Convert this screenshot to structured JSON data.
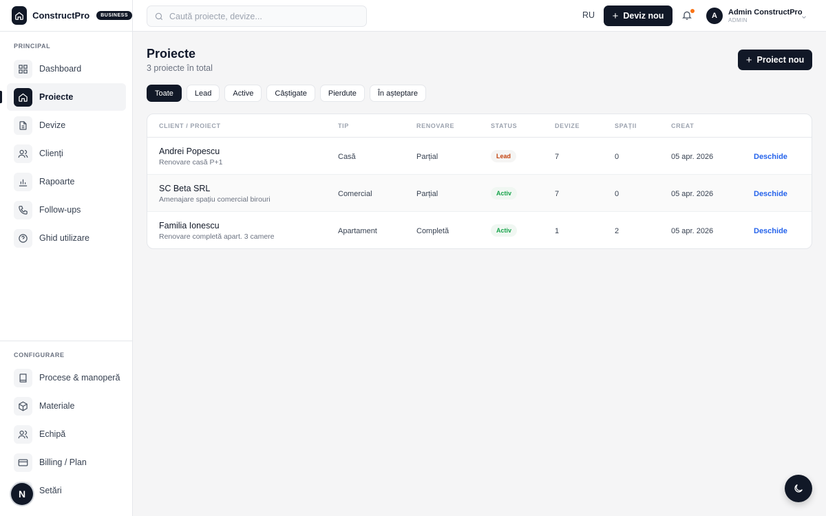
{
  "brand": {
    "name": "ConstructPro",
    "badge": "BUSINESS"
  },
  "sidebar": {
    "principal_label": "PRINCIPAL",
    "items": [
      {
        "label": "Dashboard",
        "icon": "grid-icon"
      },
      {
        "label": "Proiecte",
        "icon": "home-icon",
        "active": true
      },
      {
        "label": "Devize",
        "icon": "document-icon"
      },
      {
        "label": "Clienți",
        "icon": "users-icon"
      },
      {
        "label": "Rapoarte",
        "icon": "bar-chart-icon"
      },
      {
        "label": "Follow-ups",
        "icon": "phone-icon"
      },
      {
        "label": "Ghid utilizare",
        "icon": "help-icon"
      }
    ],
    "config_label": "CONFIGURARE",
    "config_items": [
      {
        "label": "Procese & manoperă",
        "icon": "book-icon"
      },
      {
        "label": "Materiale",
        "icon": "box-icon"
      },
      {
        "label": "Echipă",
        "icon": "team-icon"
      },
      {
        "label": "Billing / Plan",
        "icon": "credit-card-icon"
      },
      {
        "label": "Setări",
        "icon": "settings-icon"
      }
    ],
    "n_badge": "N"
  },
  "topbar": {
    "search_placeholder": "Caută proiecte, devize...",
    "lang": "RU",
    "deviz_button": "Deviz nou",
    "user": {
      "initial": "A",
      "name": "Admin ConstructPro",
      "role": "ADMIN"
    }
  },
  "main": {
    "title": "Proiecte",
    "subtitle": "3 proiecte în total",
    "new_button": "Proiect nou",
    "filters": [
      "Toate",
      "Lead",
      "Active",
      "Câștigate",
      "Pierdute",
      "În așteptare"
    ],
    "active_filter": "Toate",
    "columns": [
      "CLIENT / PROIECT",
      "TIP",
      "RENOVARE",
      "STATUS",
      "DEVIZE",
      "SPAȚII",
      "CREAT"
    ],
    "rows": [
      {
        "client": "Andrei Popescu",
        "desc": "Renovare casă P+1",
        "tip": "Casă",
        "renovare": "Parțial",
        "status": "Lead",
        "devize": "7",
        "spatii": "0",
        "creat": "05 apr. 2026",
        "action": "Deschide"
      },
      {
        "client": "SC Beta SRL",
        "desc": "Amenajare spațiu comercial birouri",
        "tip": "Comercial",
        "renovare": "Parțial",
        "status": "Activ",
        "devize": "7",
        "spatii": "0",
        "creat": "05 apr. 2026",
        "action": "Deschide"
      },
      {
        "client": "Familia Ionescu",
        "desc": "Renovare completă apart. 3 camere",
        "tip": "Apartament",
        "renovare": "Completă",
        "status": "Activ",
        "devize": "1",
        "spatii": "2",
        "creat": "05 apr. 2026",
        "action": "Deschide"
      }
    ]
  },
  "colors": {
    "primary": "#111827",
    "link": "#2563eb",
    "lead": "#c2410c",
    "active": "#16a34a",
    "notification": "#f97316"
  }
}
